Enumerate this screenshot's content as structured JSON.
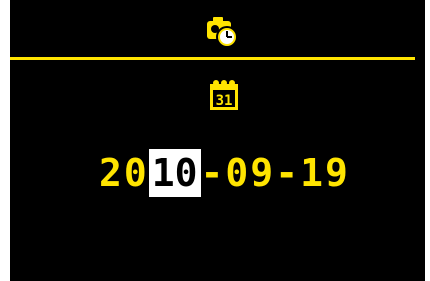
{
  "date": {
    "year_prefix": "20",
    "year_selected_digits": "10",
    "month_separator": "-",
    "month": "09",
    "day_separator": "-",
    "day": "19"
  },
  "icons": {
    "header": "camera-clock-icon",
    "section": "calendar-icon",
    "calendar_day": "31"
  },
  "colors": {
    "background": "#000000",
    "accent": "#ffe400",
    "selection": "#ffffff"
  }
}
